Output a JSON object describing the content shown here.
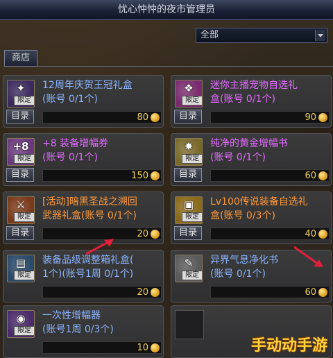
{
  "window": {
    "title": "忧心忡忡的夜市管理员"
  },
  "filter": {
    "selected": "全部"
  },
  "tabs": {
    "shop_label": "商店"
  },
  "items": [
    {
      "name": "12周年庆贺王冠礼盒\n(账号 0/1个)",
      "name_color": "#8ab4ff",
      "badge": "限定",
      "catalog": "目录",
      "price": "80",
      "icon_symbol": "✦",
      "icon_bg": "#3b2a5c"
    },
    {
      "name": "迷你主播宠物自选礼\n盒(账号 0/1个)",
      "name_color": "#e26bff",
      "badge": "限定",
      "catalog": "目录",
      "price": "90",
      "icon_symbol": "❖",
      "icon_bg": "#7a2c6e"
    },
    {
      "name": "+8 装备增幅券\n(账号 0/1个)",
      "name_color": "#e26bff",
      "badge": "限定",
      "catalog": "目录",
      "price": "150",
      "icon_symbol": "+8",
      "icon_bg": "#6a3a7c"
    },
    {
      "name": "纯净的黄金增幅书\n(账号 0/1个)",
      "name_color": "#e26bff",
      "badge": "限定",
      "catalog": "目录",
      "price": "60",
      "icon_symbol": "✸",
      "icon_bg": "#7a6a2a"
    },
    {
      "name": "[活动]暗黑圣战之溯回\n武器礼盒(账号 0/1个)",
      "name_color": "#ff9a3a",
      "badge": "限定",
      "catalog": "目录",
      "price": "20",
      "icon_symbol": "⚔",
      "icon_bg": "#7a3a1a"
    },
    {
      "name": "Lv100传说装备自选礼\n盒(账号 0/3个)",
      "name_color": "#ff9a3a",
      "badge": "限定",
      "catalog": "目录",
      "price": "40",
      "icon_symbol": "▣",
      "icon_bg": "#8a6a1a"
    },
    {
      "name": "装备品级调整箱礼盒(\n1个)(账号1周 0/1个)",
      "name_color": "#8ab4ff",
      "badge": "限定",
      "catalog": "",
      "price": "20",
      "icon_symbol": "▤",
      "icon_bg": "#2a4a6a"
    },
    {
      "name": "异界气息净化书\n(账号 0/1个)",
      "name_color": "#8ab4ff",
      "badge": "限定",
      "catalog": "",
      "price": "60",
      "icon_symbol": "✎",
      "icon_bg": "#5a5a5a"
    },
    {
      "name": "一次性增幅器\n(账号1周 0/3个)",
      "name_color": "#8ab4ff",
      "badge": "限定",
      "catalog": "",
      "price": "10",
      "icon_symbol": "◉",
      "icon_bg": "#4a2a6a"
    }
  ],
  "watermark": {
    "text": "手动动手游"
  },
  "colors": {
    "price": "#f2d25a",
    "annotation_arrow": "#e0203a"
  }
}
